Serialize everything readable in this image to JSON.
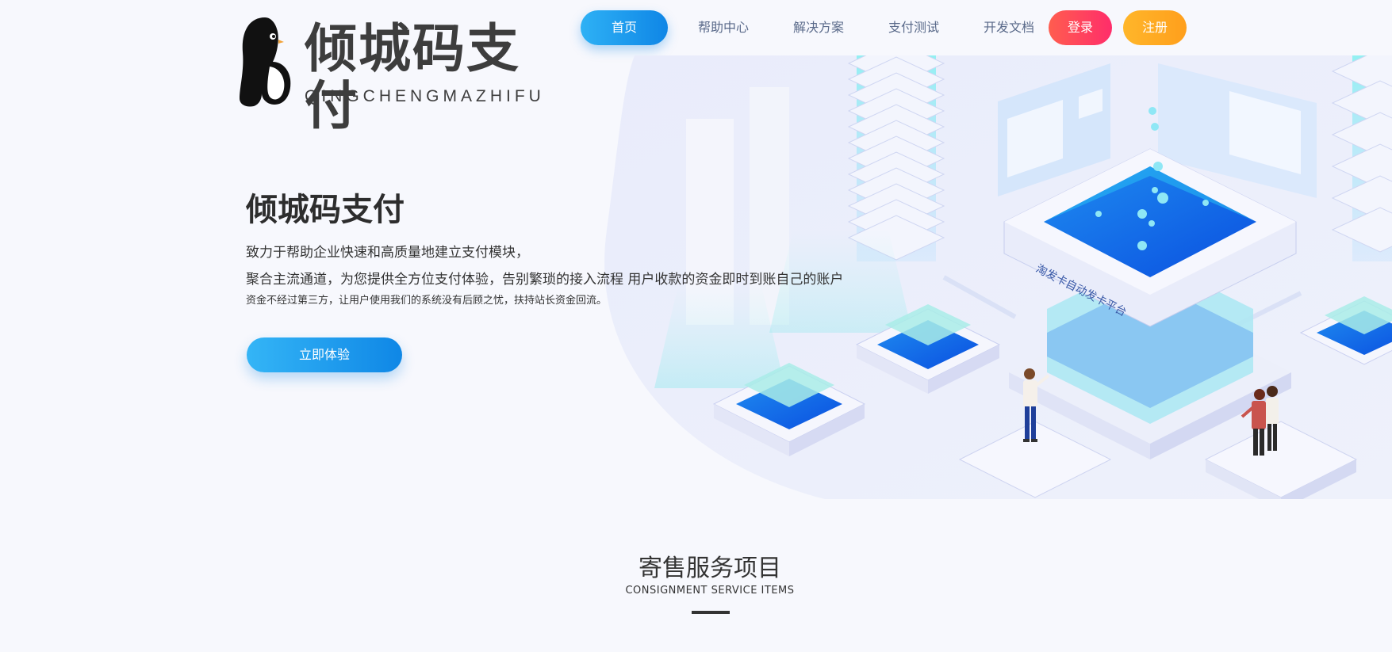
{
  "logo": {
    "title": "倾城码支付",
    "subtitle": "QINGCHENGMAZHIFU",
    "icon": "penguin-logo"
  },
  "nav": {
    "home": "首页",
    "help": "帮助中心",
    "solution": "解决方案",
    "pay_test": "支付测试",
    "docs": "开发文档",
    "login": "登录",
    "register": "注册"
  },
  "hero": {
    "title": "倾城码支付",
    "line1": "致力于帮助企业快速和高质量地建立支付模块，",
    "line2": "聚合主流通道，为您提供全方位支付体验，告别繁琐的接入流程 用户收款的资金即时到账自己的账户",
    "line3": "资金不经过第三方，让用户使用我们的系统没有后顾之忧，扶持站长资金回流。",
    "cta": "立即体验",
    "platform_label": "淘发卡自动发卡平台"
  },
  "section": {
    "title": "寄售服务项目",
    "subtitle": "CONSIGNMENT SERVICE ITEMS"
  },
  "colors": {
    "primary": "#1a93ec",
    "login": "#ff3d5f",
    "register": "#ffab22",
    "text": "#333333",
    "background": "#f7f8fd"
  }
}
